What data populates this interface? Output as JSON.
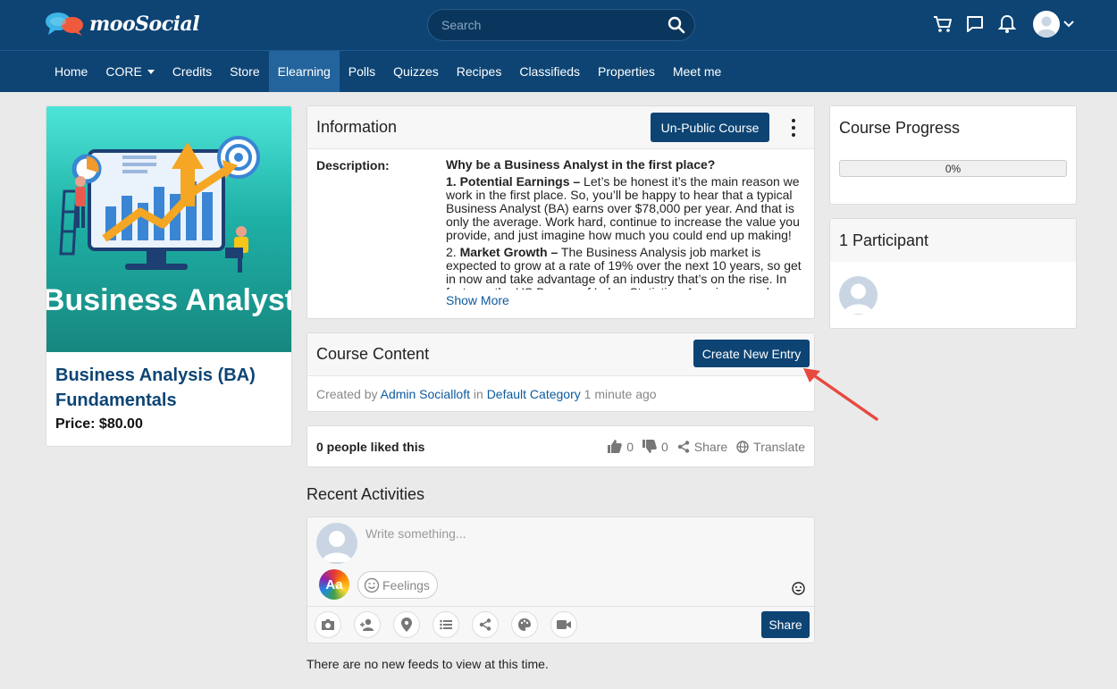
{
  "header": {
    "brand": "mooSocial",
    "search_placeholder": "Search"
  },
  "nav": {
    "items": [
      {
        "label": "Home"
      },
      {
        "label": "CORE"
      },
      {
        "label": "Credits"
      },
      {
        "label": "Store"
      },
      {
        "label": "Elearning"
      },
      {
        "label": "Polls"
      },
      {
        "label": "Quizzes"
      },
      {
        "label": "Recipes"
      },
      {
        "label": "Classifieds"
      },
      {
        "label": "Properties"
      },
      {
        "label": "Meet me"
      }
    ],
    "active": "Elearning"
  },
  "course": {
    "image_title": "Business Analyst",
    "title": "Business Analysis (BA) Fundamentals",
    "price": "Price: $80.00"
  },
  "information": {
    "heading": "Information",
    "unpublic_label": "Un-Public Course",
    "description_label": "Description:",
    "lead": "Why be a Business Analyst in the first place?",
    "p1_bold": "1. Potential Earnings –",
    "p1_text": " Let’s be honest it’s the main reason we work in the first place. So, you’ll be happy to hear that a typical Business Analyst (BA) earns over $78,000 per year. And that is only the average. Work hard, continue to increase the value you provide, and just imagine how much you could end up making!",
    "p2_prefix": "2. ",
    "p2_bold": "Market Growth –",
    "p2_text": " The Business Analysis job market is expected to grow at a rate of 19% over the next 10 years, so get in now and take advantage of an industry that’s on the rise. In fact, per the US Bureau of Labor Statistics, American employers",
    "show_more": "Show More"
  },
  "course_content": {
    "heading": "Course Content",
    "create_label": "Create New Entry",
    "created_by": "Created by",
    "author": "Admin Socialloft",
    "in": "in",
    "category": "Default Category",
    "time": "1 minute ago"
  },
  "likes": {
    "summary": "0 people liked this",
    "likes": "0",
    "dislikes": "0",
    "share": "Share",
    "translate": "Translate"
  },
  "recent": {
    "title": "Recent Activities",
    "placeholder": "Write something...",
    "aa": "Aa",
    "feelings": "Feelings",
    "share": "Share",
    "no_feeds": "There are no new feeds to view at this time."
  },
  "progress": {
    "heading": "Course Progress",
    "label": "0%",
    "value": 0
  },
  "participants": {
    "heading": "1 Participant"
  },
  "colors": {
    "primary": "#0d4474",
    "nav_active": "#24649d",
    "link": "#0d5a9e",
    "arrow": "#e8493f"
  }
}
